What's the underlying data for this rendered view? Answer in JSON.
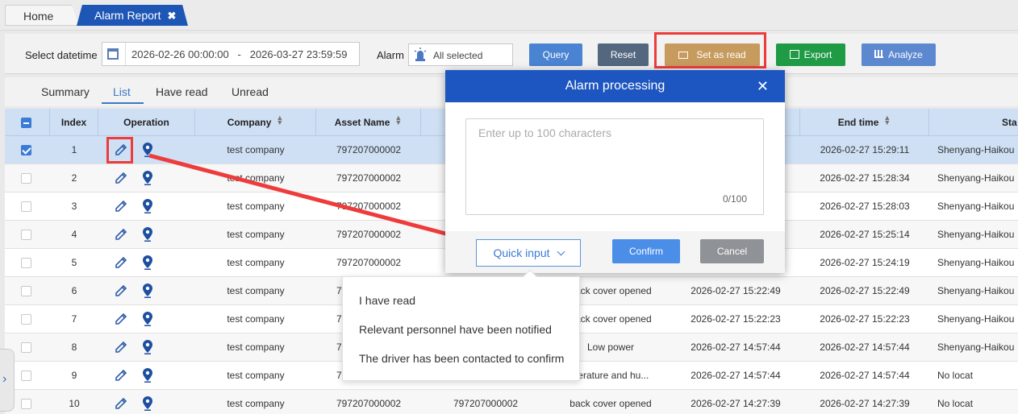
{
  "tabs": [
    {
      "label": "Home"
    },
    {
      "label": "Alarm Report",
      "close": "✖"
    }
  ],
  "filter": {
    "datetime_label": "Select datetime",
    "date_range": "2026-02-26 00:00:00   -   2026-03-27 23:59:59",
    "alarm_label": "Alarm",
    "alarm_value": "All selected",
    "query_label": "Query",
    "reset_label": "Reset",
    "setread_label": "Set as read",
    "export_label": "Export",
    "analyze_label": "Analyze"
  },
  "subtabs": [
    "Summary",
    "List",
    "Have read",
    "Unread"
  ],
  "table": {
    "headers": [
      "Index",
      "Operation",
      "Company",
      "Asset Name",
      "End time",
      "Sta"
    ],
    "rows": [
      {
        "index": "1",
        "company": "test company",
        "asset": "797207000002",
        "col5": "",
        "col6": "",
        "col7": "",
        "end": "2026-02-27 15:29:11",
        "start": "Shenyang-Haikou"
      },
      {
        "index": "2",
        "company": "test company",
        "asset": "797207000002",
        "col5": "",
        "col6": "",
        "col7": "",
        "end": "2026-02-27 15:28:34",
        "start": "Shenyang-Haikou"
      },
      {
        "index": "3",
        "company": "test company",
        "asset": "797207000002",
        "col5": "",
        "col6": "",
        "col7": "",
        "end": "2026-02-27 15:28:03",
        "start": "Shenyang-Haikou"
      },
      {
        "index": "4",
        "company": "test company",
        "asset": "797207000002",
        "col5": "",
        "col6": "",
        "col7": "",
        "end": "2026-02-27 15:25:14",
        "start": "Shenyang-Haikou"
      },
      {
        "index": "5",
        "company": "test company",
        "asset": "797207000002",
        "col5": "",
        "col6": "",
        "col7": "",
        "end": "2026-02-27 15:24:19",
        "start": "Shenyang-Haikou"
      },
      {
        "index": "6",
        "company": "test company",
        "asset": "797207000002",
        "col5": "",
        "col6": "back cover opened",
        "col7": "2026-02-27 15:22:49",
        "end": "2026-02-27 15:22:49",
        "start": "Shenyang-Haikou"
      },
      {
        "index": "7",
        "company": "test company",
        "asset": "797207000002",
        "col5": "",
        "col6": "back cover opened",
        "col7": "2026-02-27 15:22:23",
        "end": "2026-02-27 15:22:23",
        "start": "Shenyang-Haikou"
      },
      {
        "index": "8",
        "company": "test company",
        "asset": "797207000002",
        "col5": "",
        "col6": "Low power",
        "col7": "2026-02-27 14:57:44",
        "end": "2026-02-27 14:57:44",
        "start": "Shenyang-Haikou"
      },
      {
        "index": "9",
        "company": "test company",
        "asset": "797207000002",
        "col5": "",
        "col6": "perature and hu...",
        "col7": "2026-02-27 14:57:44",
        "end": "2026-02-27 14:57:44",
        "start": "No locat"
      },
      {
        "index": "10",
        "company": "test company",
        "asset": "797207000002",
        "col5": "797207000002",
        "col6": "back cover opened",
        "col7": "2026-02-27 14:27:39",
        "end": "2026-02-27 14:27:39",
        "start": "No locat"
      }
    ]
  },
  "dialog": {
    "title": "Alarm processing",
    "close": "✕",
    "placeholder": "Enter up to 100 characters",
    "counter": "0/100",
    "quick_input": "Quick input",
    "confirm": "Confirm",
    "cancel": "Cancel"
  },
  "dropdown": {
    "items": [
      "I have read",
      "Relevant personnel have been notified",
      "The driver has been contacted to confirm"
    ]
  },
  "colors": {
    "accent": "#1d56c0",
    "highlight": "#ee3b3b"
  }
}
